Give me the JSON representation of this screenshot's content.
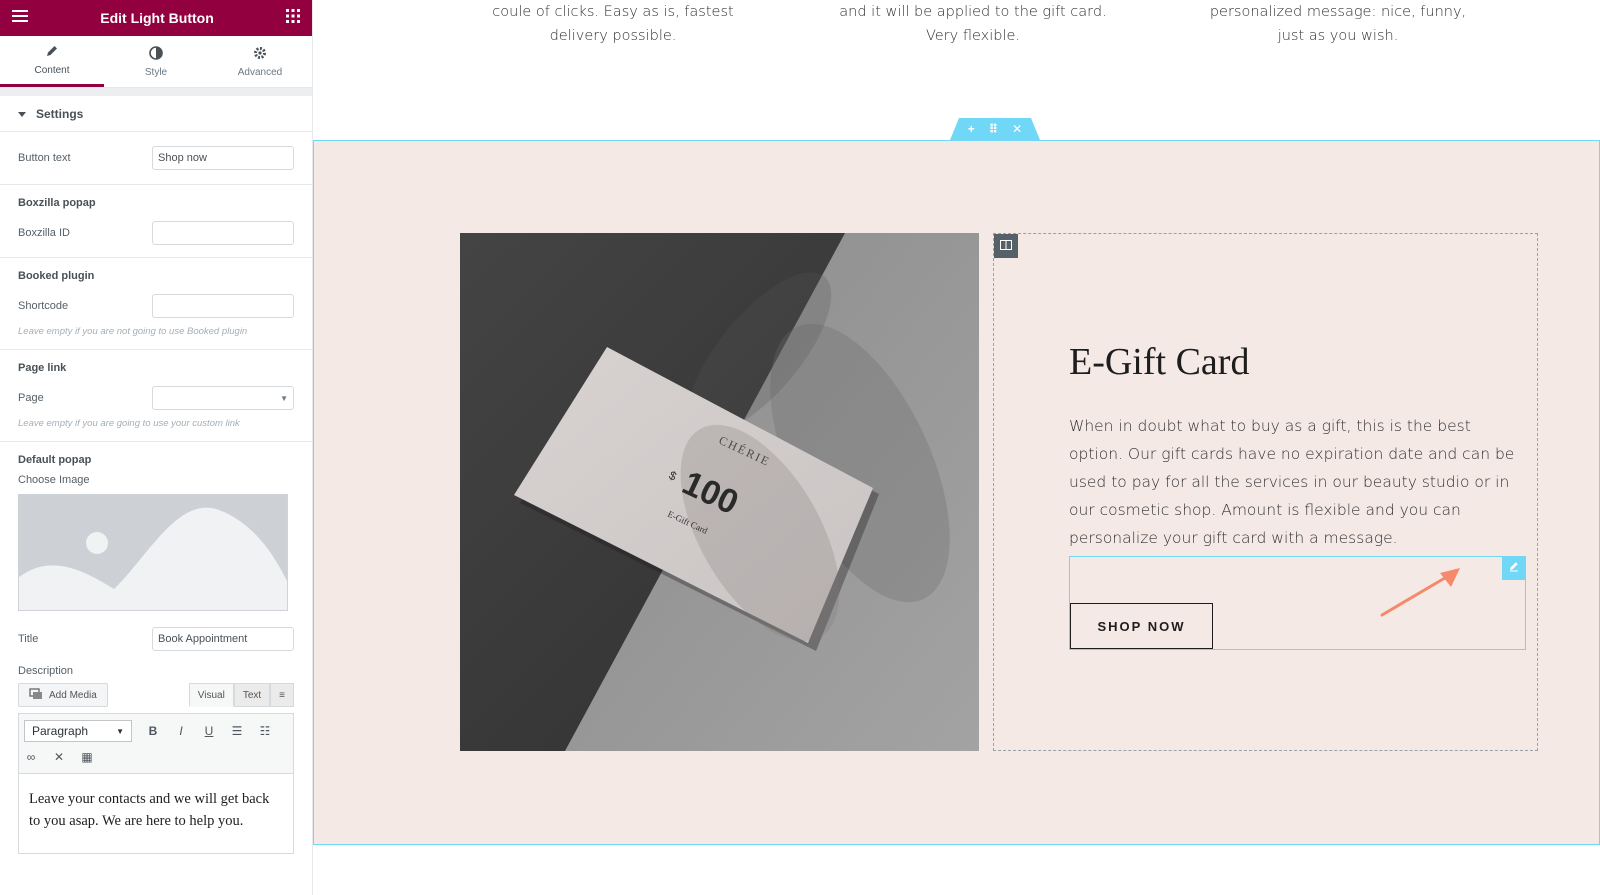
{
  "panel": {
    "title": "Edit Light Button",
    "tabs": [
      {
        "label": "Content",
        "icon": "pencil-icon"
      },
      {
        "label": "Style",
        "icon": "half-circle-icon"
      },
      {
        "label": "Advanced",
        "icon": "gear-icon"
      }
    ],
    "settings_heading": "Settings",
    "button_text_label": "Button text",
    "button_text_value": "Shop now",
    "boxzilla": {
      "heading": "Boxzilla popap",
      "id_label": "Boxzilla ID",
      "id_value": ""
    },
    "booked": {
      "heading": "Booked plugin",
      "shortcode_label": "Shortcode",
      "shortcode_value": "",
      "note": "Leave empty if you are not going to use Booked plugin"
    },
    "page_link": {
      "heading": "Page link",
      "page_label": "Page",
      "page_value": "",
      "note": "Leave empty if you are going to use your custom link"
    },
    "default_popap": {
      "heading": "Default popap",
      "choose_image_label": "Choose Image",
      "title_label": "Title",
      "title_value": "Book Appointment",
      "description_label": "Description"
    },
    "editor": {
      "add_media": "Add Media",
      "visual_tab": "Visual",
      "text_tab": "Text",
      "format_select": "Paragraph",
      "content": "Leave your contacts and we will get back to you asap. We are here to help you."
    }
  },
  "canvas": {
    "top_columns": [
      {
        "line1": "coule of clicks. Easy as is, fastest",
        "line2": "delivery possible."
      },
      {
        "line1": "and it will be applied to the gift card.",
        "line2": "Very flexible."
      },
      {
        "line1": "personalized message: nice, funny,",
        "line2": "just as you wish."
      }
    ],
    "card": {
      "brand": "CHÉRIE",
      "amount_prefix": "$",
      "amount": "100",
      "subtitle": "E-Gift Card"
    },
    "heading": "E-Gift Card",
    "description": "When in doubt what to buy as a gift, this is the best option. Our gift cards have no expiration date and can be used to pay for all the services in our beauty studio or in our cosmetic shop. Amount is flexible and you can personalize your gift card with a message.",
    "button_label": "SHOP NOW"
  },
  "colors": {
    "panel_header": "#93003f",
    "section_bg": "#f5e9e6",
    "highlight": "#71d7f7",
    "arrow": "#f4896b"
  }
}
